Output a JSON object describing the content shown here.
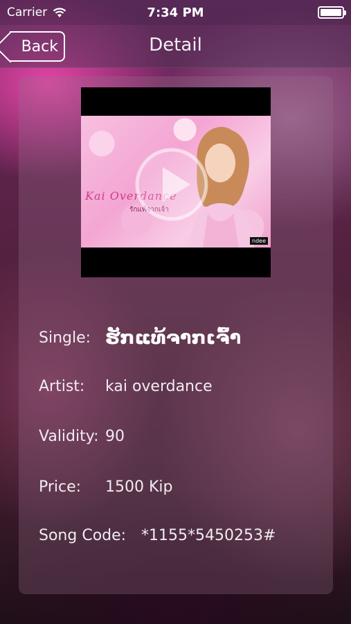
{
  "status_bar": {
    "carrier": "Carrier",
    "time": "7:34 PM",
    "wifi_icon": "wifi-icon",
    "battery_icon": "battery-icon",
    "battery_level": 1.0
  },
  "nav": {
    "back_label": "Back",
    "title": "Detail"
  },
  "video": {
    "thumbnail_icon": "play-icon",
    "album_logo": "Kai Overdance",
    "album_subtitle": "รักแท้จากเจ้า",
    "watermark": "ndee"
  },
  "details": {
    "single_label": "Single:",
    "single_value": "ຮັກແທ້ຈາກເຈົ້າ",
    "artist_label": "Artist:",
    "artist_value": "kai overdance",
    "validity_label": "Validity:",
    "validity_value": "90",
    "price_label": "Price:",
    "price_value": "1500 Kip",
    "code_label": "Song Code:",
    "code_value": "*1155*5450253#"
  },
  "colors": {
    "accent_pink": "#eb46aa",
    "text": "#ffffff"
  }
}
